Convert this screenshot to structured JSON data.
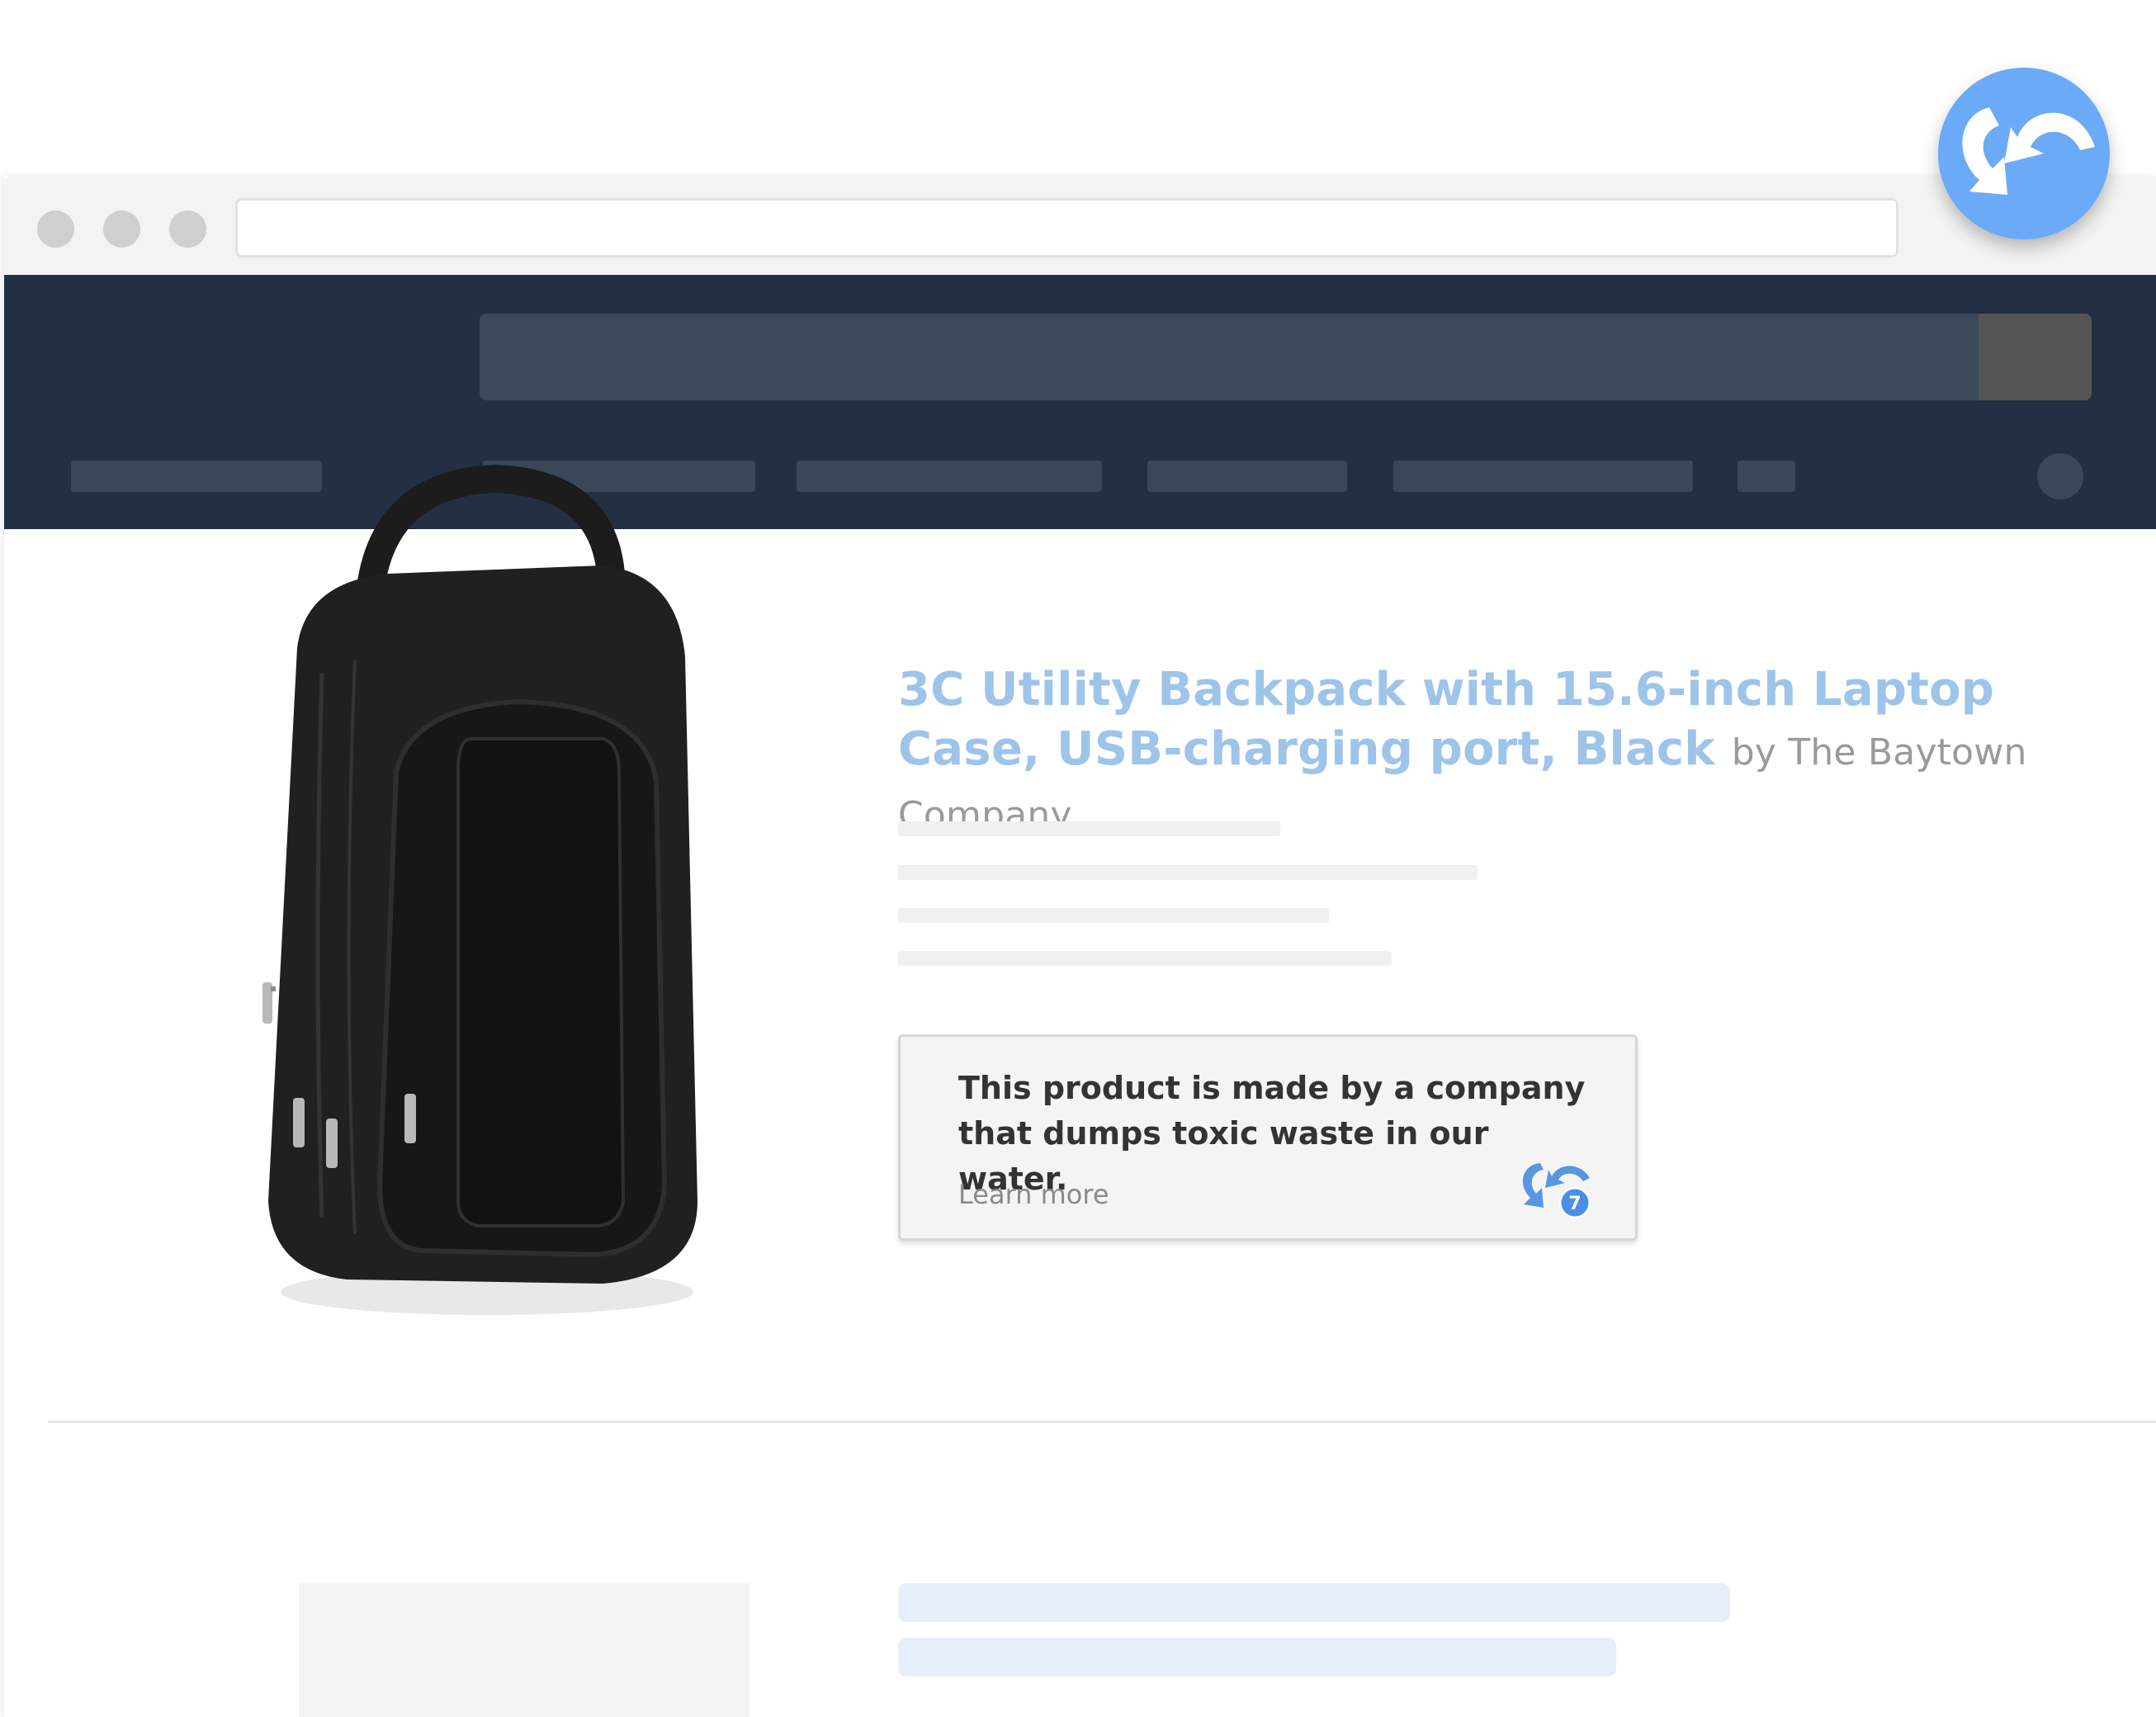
{
  "browser": {
    "url": ""
  },
  "site": {
    "nav_items": [
      "",
      "",
      "",
      "",
      "",
      ""
    ]
  },
  "product": {
    "title": "3C Utility Backpack with 15.6-inch Laptop Case, USB-charging port, Black",
    "byline": "by The Baytown Company"
  },
  "alert": {
    "message": "This product is made by a company that dumps toxic waste in our water.",
    "link_label": "Learn more",
    "badge_count": "7"
  },
  "icons": {
    "extension": "share-arrows-icon",
    "alert_logo": "share-arrows-icon"
  },
  "colors": {
    "accent": "#6aaaf6",
    "header_bg": "#232f42",
    "title": "#9ec4ea"
  }
}
